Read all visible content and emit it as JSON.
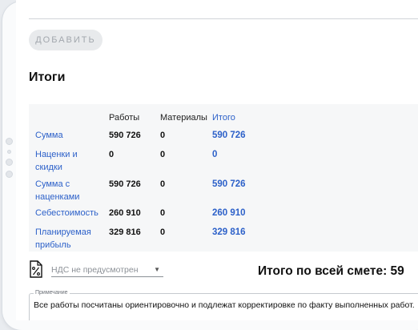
{
  "toolbar": {
    "add_label": "ДОБАВИТЬ"
  },
  "section_title": "Итоги",
  "table": {
    "columns": [
      "",
      "Работы",
      "Материалы",
      "Итого"
    ],
    "rows": [
      {
        "label": "Сумма",
        "works": "590 726",
        "materials": "0",
        "total": "590 726"
      },
      {
        "label": "Наценки и скидки",
        "works": "0",
        "materials": "0",
        "total": "0"
      },
      {
        "label": "Сумма с наценками",
        "works": "590 726",
        "materials": "0",
        "total": "590 726"
      },
      {
        "label": "Себестоимость",
        "works": "260 910",
        "materials": "0",
        "total": "260 910"
      },
      {
        "label": "Планируемая прибыль",
        "works": "329 816",
        "materials": "0",
        "total": "329 816"
      }
    ]
  },
  "nds": {
    "placeholder": "НДС не предусмотрен",
    "icon": "percent-document-icon"
  },
  "grand_total_label": "Итого по всей смете: 59",
  "note": {
    "legend": "Примечание",
    "text": "Все работы посчитаны ориентировочно и подлежат корректировке по факту выполненных работ."
  },
  "colors": {
    "accent": "#2d61c9",
    "panel": "#f6f7f8"
  }
}
